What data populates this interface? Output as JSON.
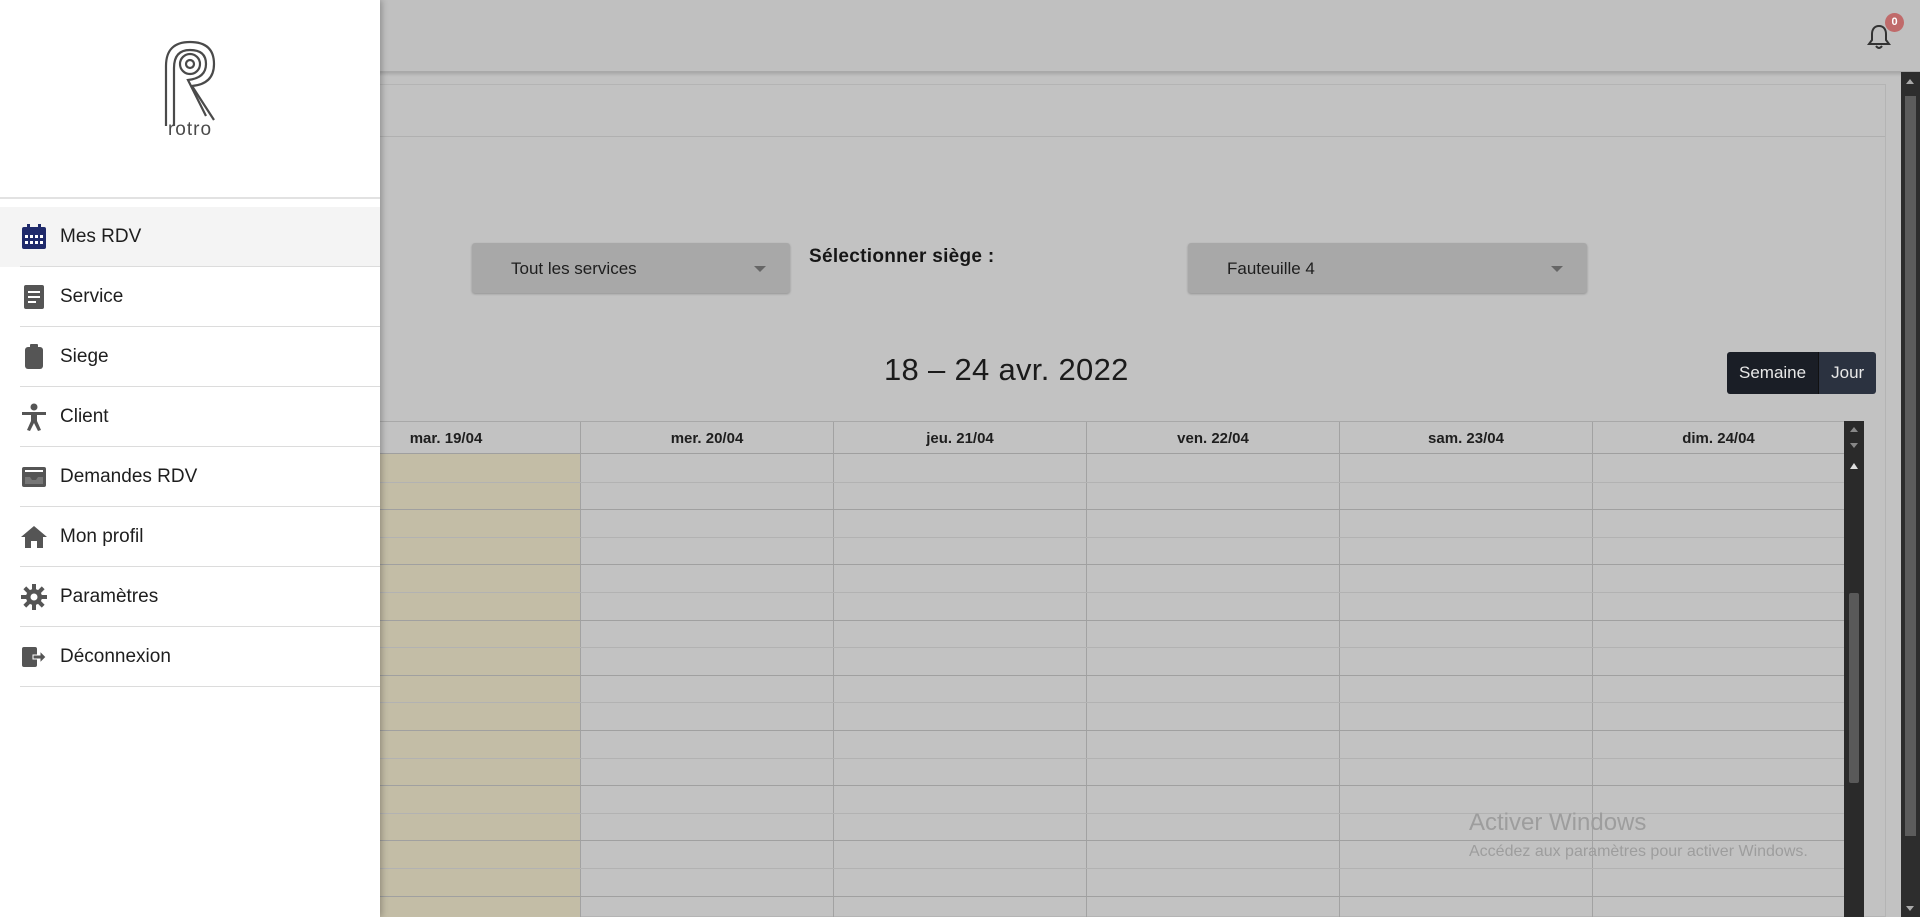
{
  "brand": {
    "logo_text": "rotro"
  },
  "header": {
    "notification_count": "0"
  },
  "sidebar": {
    "items": [
      {
        "label": "Mes RDV",
        "icon": "calendar-icon",
        "active": true
      },
      {
        "label": "Service",
        "icon": "document-icon"
      },
      {
        "label": "Siege",
        "icon": "clipboard-icon"
      },
      {
        "label": "Client",
        "icon": "accessibility-icon"
      },
      {
        "label": "Demandes RDV",
        "icon": "inbox-icon"
      },
      {
        "label": "Mon profil",
        "icon": "home-icon"
      },
      {
        "label": "Paramètres",
        "icon": "gear-icon"
      },
      {
        "label": "Déconnexion",
        "icon": "logout-icon"
      }
    ]
  },
  "filters": {
    "service_label_colon": ":",
    "service_value": "Tout les services",
    "siege_label": "Sélectionner siège :",
    "siege_value": "Fauteuille 4"
  },
  "calendar": {
    "range_title": "18 – 24 avr. 2022",
    "view_week": "Semaine",
    "view_day": "Jour",
    "days": [
      "mar. 19/04",
      "mer. 20/04",
      "jeu. 21/04",
      "ven. 22/04",
      "sam. 23/04",
      "dim. 24/04"
    ]
  },
  "watermark": {
    "line1": "Activer Windows",
    "line2": "Accédez aux paramètres pour activer Windows."
  },
  "colors": {
    "accent": "#1f2a6b",
    "today_column": "#c3bda6",
    "toggle_dark": "#1a1e26"
  }
}
